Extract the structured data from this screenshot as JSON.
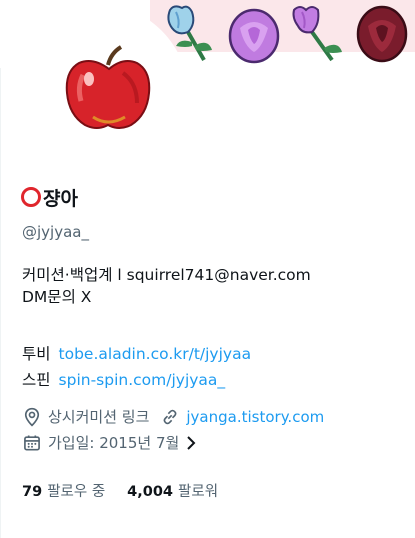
{
  "profile": {
    "display_name": "쟝아",
    "handle": "@jyjyaa_",
    "bio": "커미션·백업계 l squirrel741@naver.com\nDM문의 X",
    "links": [
      {
        "label": "투비",
        "url": "tobe.aladin.co.kr/t/jyjyaa"
      },
      {
        "label": "스핀",
        "url": "spin-spin.com/jyjyaa_"
      }
    ],
    "location": "상시커미션 링크",
    "website": "jyanga.tistory.com",
    "joined": "가입일: 2015년 7월",
    "following_count": "79",
    "following_label": "팔로우 중",
    "followers_count": "4,004",
    "followers_label": "팔로워"
  },
  "icons": {
    "name_emoji": "red-circle-ring-icon",
    "location": "location-pin-icon",
    "website": "link-icon",
    "joined": "calendar-icon",
    "joined_more": "chevron-right-icon"
  },
  "colors": {
    "link": "#1d9bf0",
    "secondary_text": "#536471",
    "banner_bg": "#fbe7ea",
    "apple": "#d7232a"
  }
}
